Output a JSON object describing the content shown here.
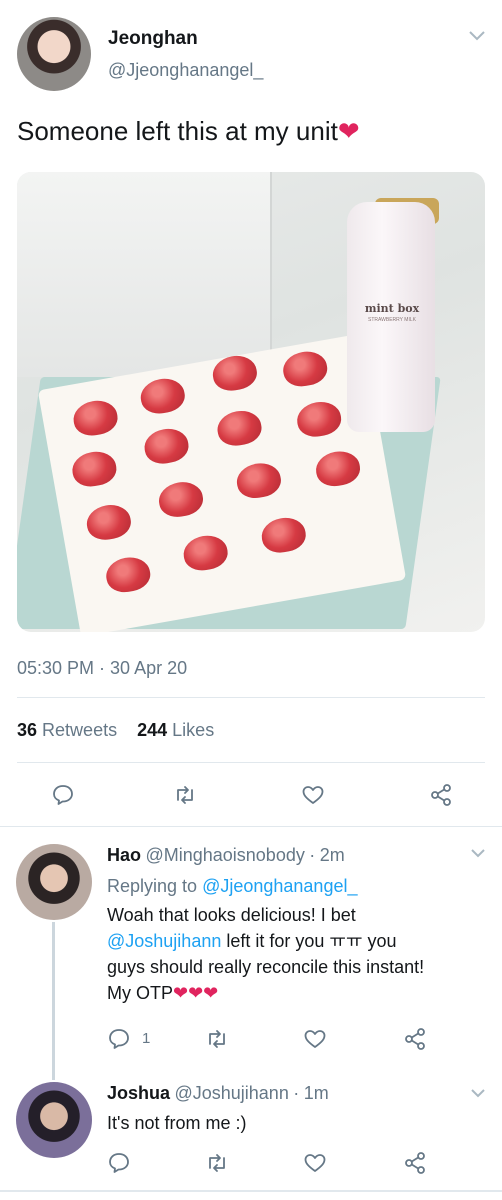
{
  "main_tweet": {
    "display_name": "Jeonghan",
    "handle": "@Jjeonghanangel_",
    "text": "Someone left this at my unit",
    "text_emoji": "❤",
    "photo": {
      "bottle_brand": "mint box",
      "bottle_subtitle": "STRAWBERRY MILK"
    },
    "timestamp": "05:30 PM · 30 Apr 20",
    "retweets_count": "36",
    "retweets_label": "Retweets",
    "likes_count": "244",
    "likes_label": "Likes"
  },
  "replies": [
    {
      "display_name": "Hao",
      "handle": "@Minghaoisnobody",
      "dot": "·",
      "time": "2m",
      "replying_to_label": "Replying to",
      "replying_to_handle": "@Jjeonghanangel_",
      "text_line1": "Woah that looks delicious! I bet",
      "mention": "@Joshujihann",
      "text_line2_rest": " left it for you ㅠㅠ you",
      "text_line3": "guys should really reconcile this instant!",
      "text_line4": "My OTP",
      "text_line4_emoji": "❤❤❤",
      "reply_count": "1"
    },
    {
      "display_name": "Joshua",
      "handle": "@Joshujihann",
      "dot": "·",
      "time": "1m",
      "text": "It's not from me :)"
    }
  ],
  "icons": {
    "reply": "reply-icon",
    "retweet": "retweet-icon",
    "like": "heart-icon",
    "share": "share-icon",
    "caret": "chevron-down-icon"
  },
  "colors": {
    "link": "#1da1f2",
    "secondary_text": "#657786",
    "heart_emoji": "#e0245e"
  }
}
